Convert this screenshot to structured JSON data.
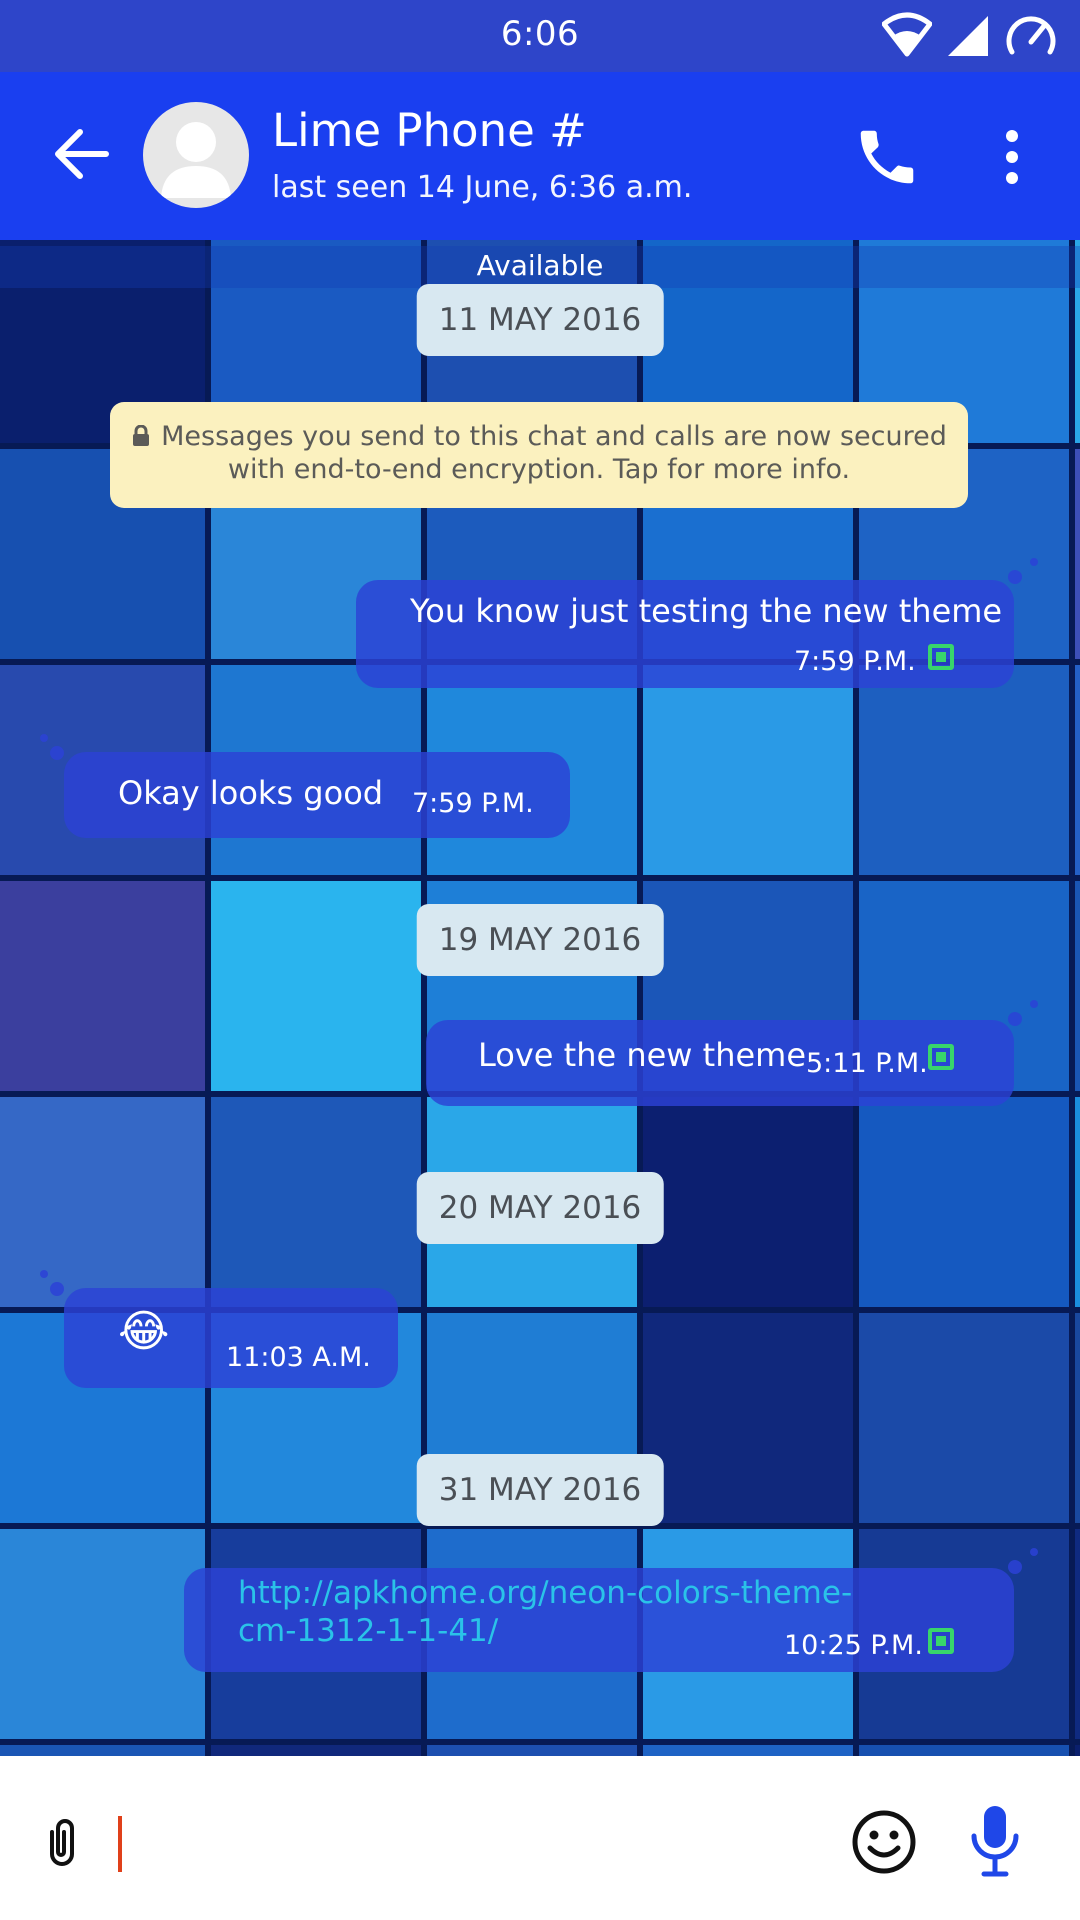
{
  "status_bar": {
    "time": "6:06",
    "icons": [
      "wifi-icon",
      "signal-icon",
      "data-saver-icon"
    ]
  },
  "header": {
    "contact_name": "Lime Phone #",
    "last_seen": "last seen 14 June, 6:36 a.m.",
    "icons": [
      "back-arrow-icon",
      "avatar",
      "phone-icon",
      "more-vert-icon"
    ]
  },
  "chat": {
    "status_label": "Available",
    "encryption_notice_line1": "Messages you send to this chat and calls are now secured",
    "encryption_notice_line2": "with end-to-end encryption. Tap for more info.",
    "dates": [
      "11 MAY 2016",
      "19 MAY 2016",
      "20 MAY 2016",
      "31 MAY 2016"
    ],
    "messages": [
      {
        "direction": "outgoing",
        "text": "You know just testing the new theme",
        "time": "7:59 P.M."
      },
      {
        "direction": "incoming",
        "text": "Okay looks good",
        "time": "7:59 P.M."
      },
      {
        "direction": "outgoing",
        "text": "Love the new theme",
        "time": "5:11 P.M."
      },
      {
        "direction": "incoming",
        "text": "😂",
        "time": "11:03 A.M."
      },
      {
        "direction": "outgoing",
        "link_line1": "http://apkhome.org/neon-colors-theme-",
        "link_line2": "cm-1312-1-1-41/",
        "time": "10:25 P.M."
      }
    ]
  },
  "input": {
    "value": "",
    "placeholder": ""
  },
  "colors": {
    "status_bar": "#2e45c9",
    "app_bar": "#1a3ff0",
    "bubble": "#2c42d6",
    "date_chip": "#d8e8f1",
    "notice": "#fbf1bf",
    "read_tick": "#38d56b",
    "link": "#2ac3e8",
    "mic": "#1f47e8"
  }
}
